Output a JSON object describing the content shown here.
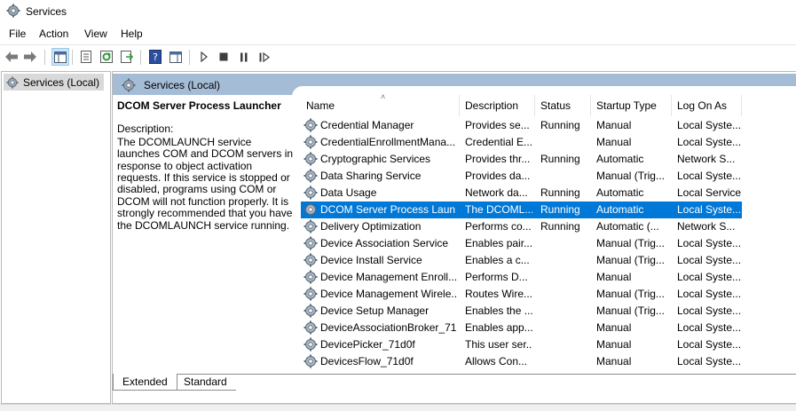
{
  "window": {
    "title": "Services"
  },
  "menu": [
    "File",
    "Action",
    "View",
    "Help"
  ],
  "toolbar": {
    "icons": [
      "back-icon",
      "forward-icon",
      "show-hide-tree-icon",
      "properties-icon",
      "refresh-icon",
      "export-list-icon",
      "help-icon",
      "action-pane-icon",
      "start-service-icon",
      "stop-service-icon",
      "pause-service-icon",
      "restart-service-icon"
    ]
  },
  "tree": {
    "root_label": "Services (Local)"
  },
  "banner": {
    "label": "Services (Local)"
  },
  "description": {
    "service_name": "DCOM Server Process Launcher",
    "label": "Description:",
    "text": "The DCOMLAUNCH service launches COM and DCOM servers in response to object activation requests. If this service is stopped or disabled, programs using COM or DCOM will not function properly. It is strongly recommended that you have the DCOMLAUNCH service running."
  },
  "columns": [
    "Name",
    "Description",
    "Status",
    "Startup Type",
    "Log On As"
  ],
  "rows": [
    {
      "name": "Credential Manager",
      "description": "Provides se...",
      "status": "Running",
      "startup": "Manual",
      "logon": "Local Syste..."
    },
    {
      "name": "CredentialEnrollmentMana...",
      "description": "Credential E...",
      "status": "",
      "startup": "Manual",
      "logon": "Local Syste..."
    },
    {
      "name": "Cryptographic Services",
      "description": "Provides thr...",
      "status": "Running",
      "startup": "Automatic",
      "logon": "Network S..."
    },
    {
      "name": "Data Sharing Service",
      "description": "Provides da...",
      "status": "",
      "startup": "Manual (Trig...",
      "logon": "Local Syste..."
    },
    {
      "name": "Data Usage",
      "description": "Network da...",
      "status": "Running",
      "startup": "Automatic",
      "logon": "Local Service"
    },
    {
      "name": "DCOM Server Process Laun...",
      "description": "The DCOML...",
      "status": "Running",
      "startup": "Automatic",
      "logon": "Local Syste...",
      "selected": true
    },
    {
      "name": "Delivery Optimization",
      "description": "Performs co...",
      "status": "Running",
      "startup": "Automatic (...",
      "logon": "Network S..."
    },
    {
      "name": "Device Association Service",
      "description": "Enables pair...",
      "status": "",
      "startup": "Manual (Trig...",
      "logon": "Local Syste..."
    },
    {
      "name": "Device Install Service",
      "description": "Enables a c...",
      "status": "",
      "startup": "Manual (Trig...",
      "logon": "Local Syste..."
    },
    {
      "name": "Device Management Enroll...",
      "description": "Performs D...",
      "status": "",
      "startup": "Manual",
      "logon": "Local Syste..."
    },
    {
      "name": "Device Management Wirele...",
      "description": "Routes Wire...",
      "status": "",
      "startup": "Manual (Trig...",
      "logon": "Local Syste..."
    },
    {
      "name": "Device Setup Manager",
      "description": "Enables the ...",
      "status": "",
      "startup": "Manual (Trig...",
      "logon": "Local Syste..."
    },
    {
      "name": "DeviceAssociationBroker_71...",
      "description": "Enables app...",
      "status": "",
      "startup": "Manual",
      "logon": "Local Syste..."
    },
    {
      "name": "DevicePicker_71d0f",
      "description": "This user ser...",
      "status": "",
      "startup": "Manual",
      "logon": "Local Syste..."
    },
    {
      "name": "DevicesFlow_71d0f",
      "description": "Allows Con...",
      "status": "",
      "startup": "Manual",
      "logon": "Local Syste..."
    }
  ],
  "tabs": [
    "Extended",
    "Standard"
  ],
  "colors": {
    "selection": "#0078d7",
    "banner": "#a5bcd6"
  }
}
